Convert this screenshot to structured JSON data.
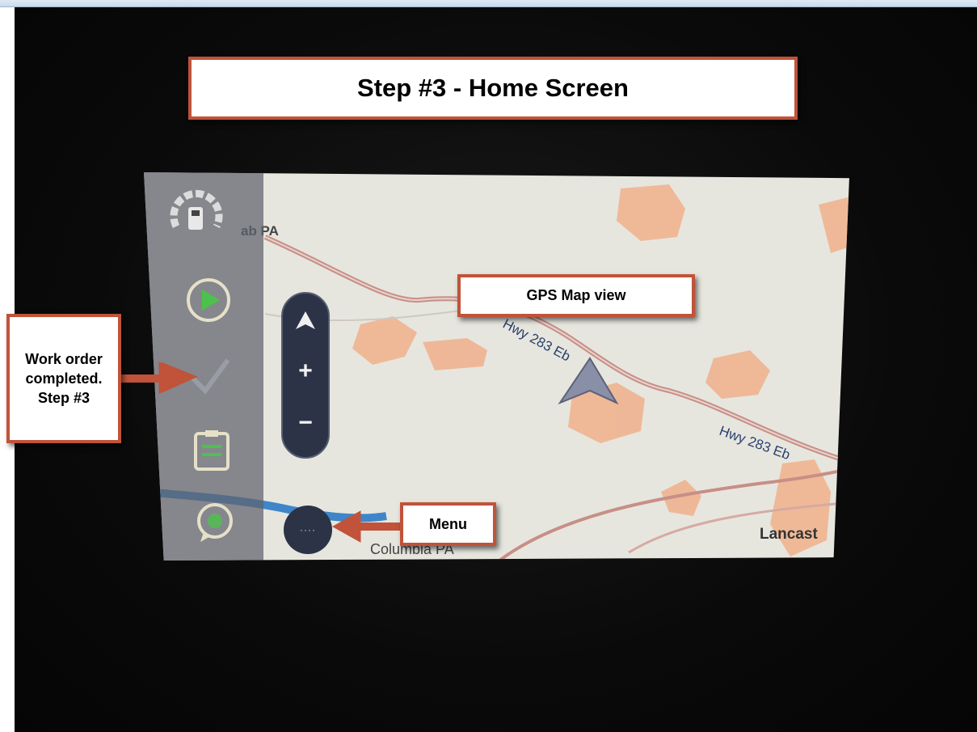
{
  "annotations": {
    "title": "Step #3 - Home Screen",
    "gps_map_view": "GPS Map view",
    "menu": "Menu",
    "work_order_lines": [
      "Work order",
      "completed.",
      "Step #3"
    ]
  },
  "map": {
    "road_label_1": "Hwy 283 Eb",
    "road_label_2": "Hwy 283 Eb",
    "place_top_left": "ab   PA",
    "place_bottom": "Columbia PA",
    "place_bottom_right": "Lancast"
  },
  "zoom": {
    "plus": "+",
    "minus": "−"
  },
  "menu_button": "····",
  "colors": {
    "callout_border": "#c0533a",
    "arrow": "#c0533a",
    "map_bg": "#e6e6df",
    "urban_area": "#f0b08c",
    "control_bg": "#2d3347",
    "play_green": "#4cc24c",
    "water": "#3e86c9"
  },
  "icons": [
    "fuel-gauge-icon",
    "play-icon",
    "checkmark-icon",
    "clipboard-icon",
    "chat-icon",
    "navigation-arrow-icon",
    "up-arrow-icon"
  ]
}
